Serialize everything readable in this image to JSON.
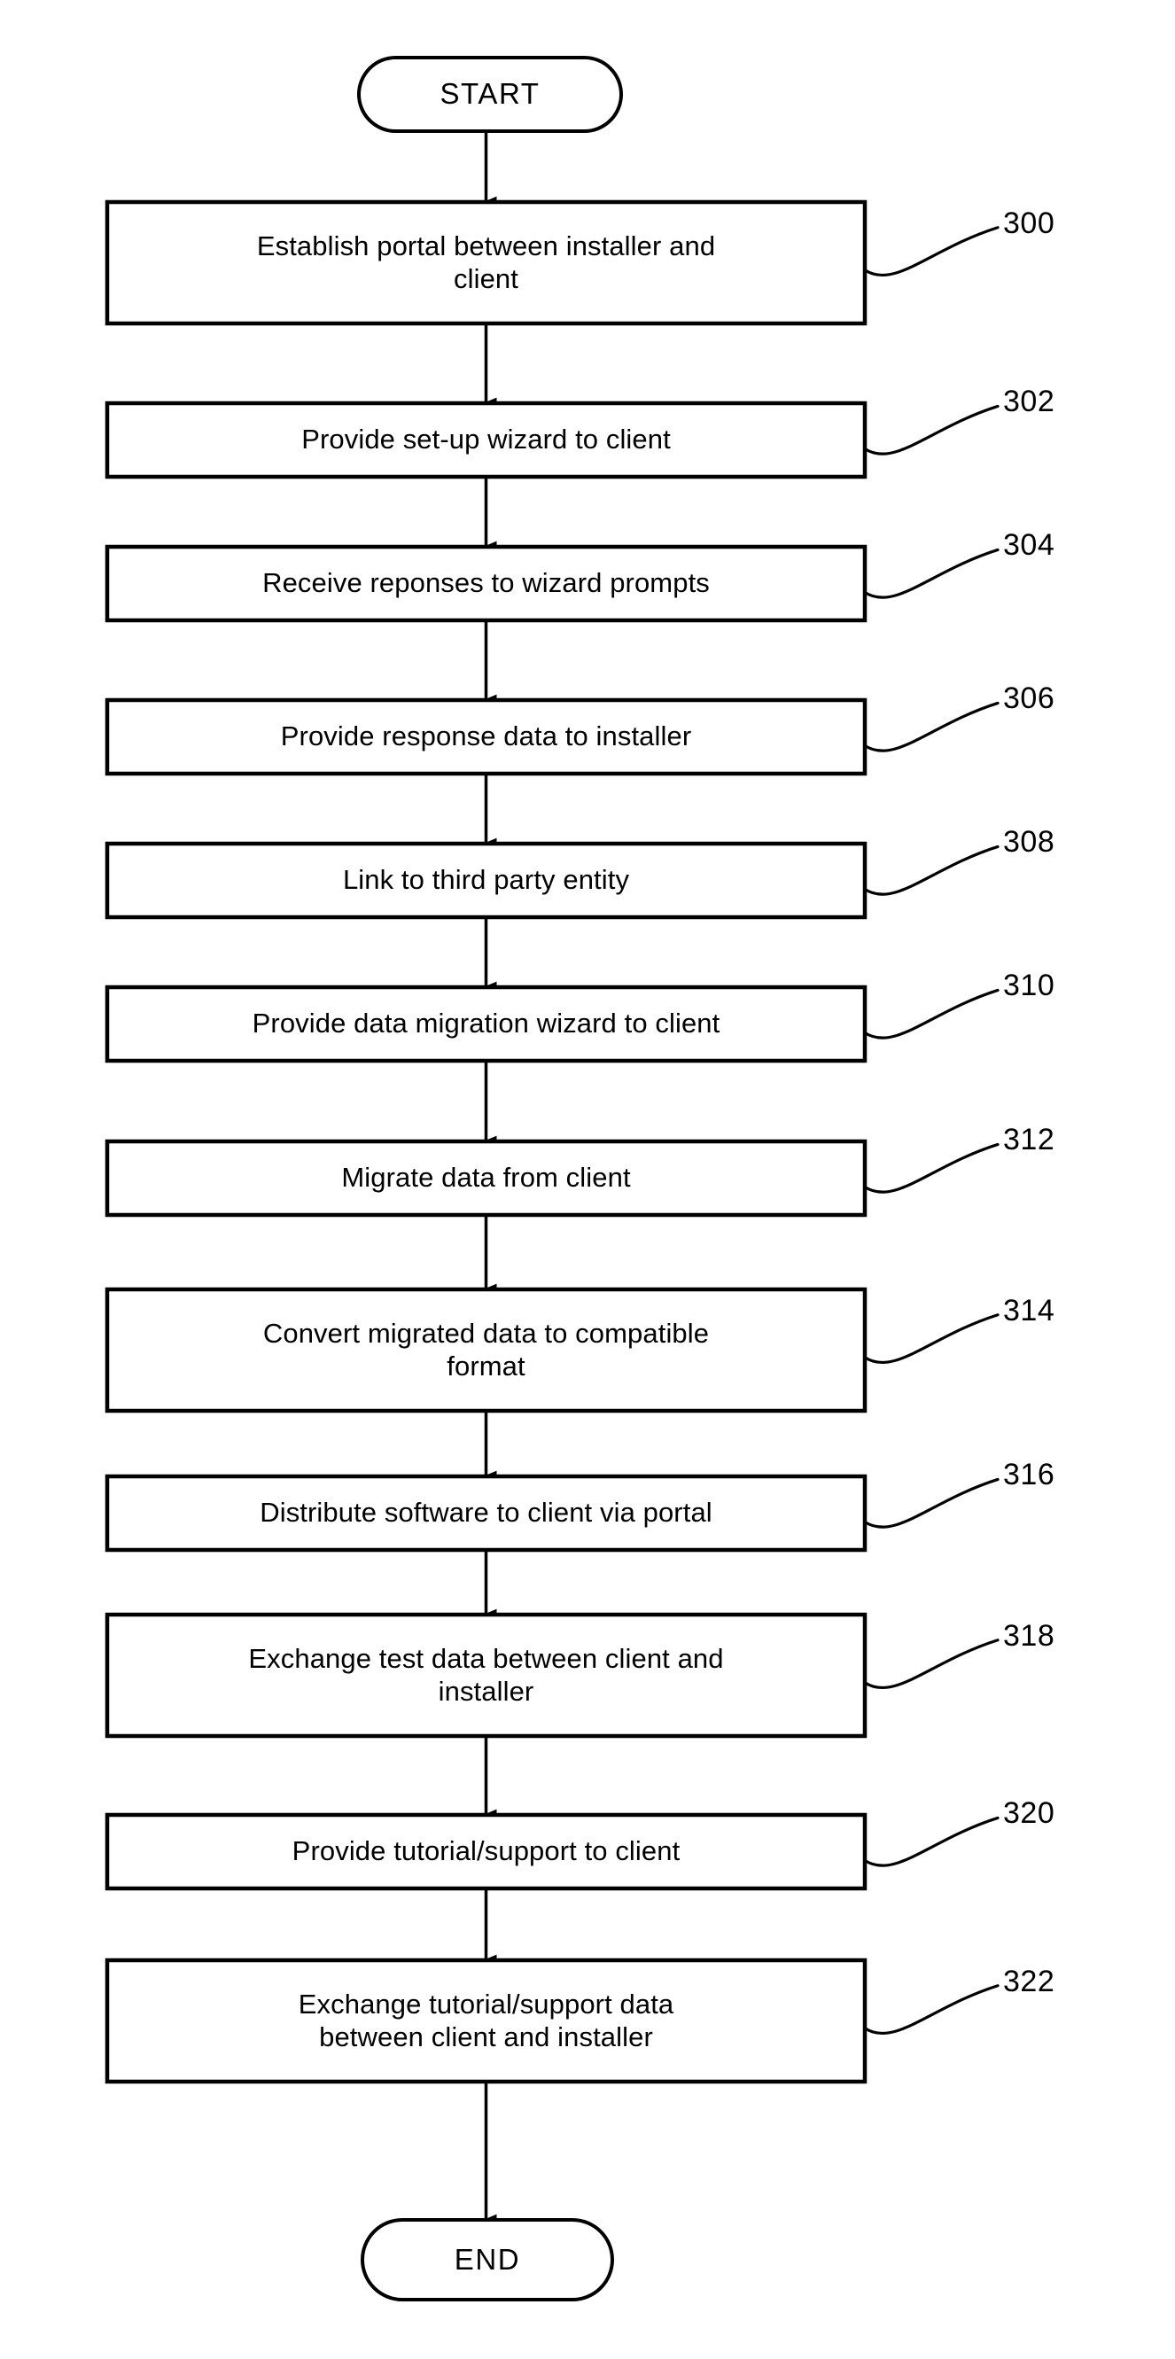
{
  "figure": {
    "type": "flowchart",
    "orientation": "vertical",
    "background_color": "#ffffff",
    "line_color": "#000000"
  },
  "terminals": {
    "start": {
      "label": "START",
      "shape": "stadium"
    },
    "end": {
      "label": "END",
      "shape": "stadium"
    }
  },
  "steps": [
    {
      "ref": "300",
      "label": "Establish portal between installer and\nclient",
      "lines": 2
    },
    {
      "ref": "302",
      "label": "Provide set-up wizard to client",
      "lines": 1
    },
    {
      "ref": "304",
      "label": "Receive reponses to wizard prompts",
      "lines": 1
    },
    {
      "ref": "306",
      "label": "Provide response data to installer",
      "lines": 1
    },
    {
      "ref": "308",
      "label": "Link to third party entity",
      "lines": 1
    },
    {
      "ref": "310",
      "label": "Provide data migration wizard to client",
      "lines": 1
    },
    {
      "ref": "312",
      "label": "Migrate data from client",
      "lines": 1
    },
    {
      "ref": "314",
      "label": "Convert migrated data to compatible\nformat",
      "lines": 2
    },
    {
      "ref": "316",
      "label": "Distribute software to client via portal",
      "lines": 1
    },
    {
      "ref": "318",
      "label": "Exchange test data between client and\ninstaller",
      "lines": 2
    },
    {
      "ref": "320",
      "label": "Provide tutorial/support to client",
      "lines": 1
    },
    {
      "ref": "322",
      "label": "Exchange tutorial/support data\nbetween client and installer",
      "lines": 2
    }
  ]
}
